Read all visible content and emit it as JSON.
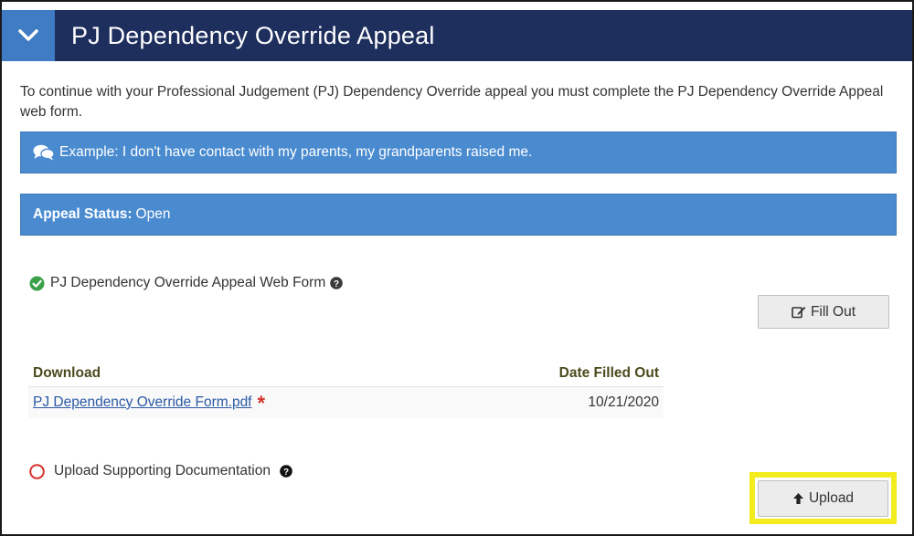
{
  "header": {
    "title": "PJ Dependency Override Appeal",
    "toggle_icon": "chevron-down-icon"
  },
  "intro": {
    "text": "To continue with your Professional Judgement (PJ) Dependency Override appeal you must complete the PJ Dependency Override Appeal web form."
  },
  "example_banner": {
    "icon": "comments-icon",
    "text": "Example: I don't have contact with my parents, my grandparents raised me."
  },
  "status_banner": {
    "label": "Appeal Status:",
    "value": "Open"
  },
  "webform": {
    "status_icon": "check-circle-icon",
    "label": "PJ Dependency Override Appeal Web Form",
    "help_icon": "question-circle-icon",
    "fill_out_button": "Fill Out",
    "fill_out_icon": "edit-icon"
  },
  "downloads_table": {
    "columns": [
      "Download",
      "Date Filled Out"
    ],
    "rows": [
      {
        "file": "PJ Dependency Override Form.pdf",
        "required_mark": "*",
        "date": "10/21/2020"
      }
    ]
  },
  "upload": {
    "status_icon": "empty-circle-icon",
    "label": "Upload Supporting Documentation",
    "help_icon": "question-circle-icon",
    "button": "Upload",
    "button_icon": "arrow-up-icon"
  },
  "colors": {
    "header_bg": "#1e2f5e",
    "toggle_bg": "#3f7cc3",
    "banner_bg": "#4a8bd0",
    "success": "#3aa04a",
    "pending": "#d3302a",
    "highlight": "#f3ec1f",
    "link": "#2a5aa6"
  }
}
